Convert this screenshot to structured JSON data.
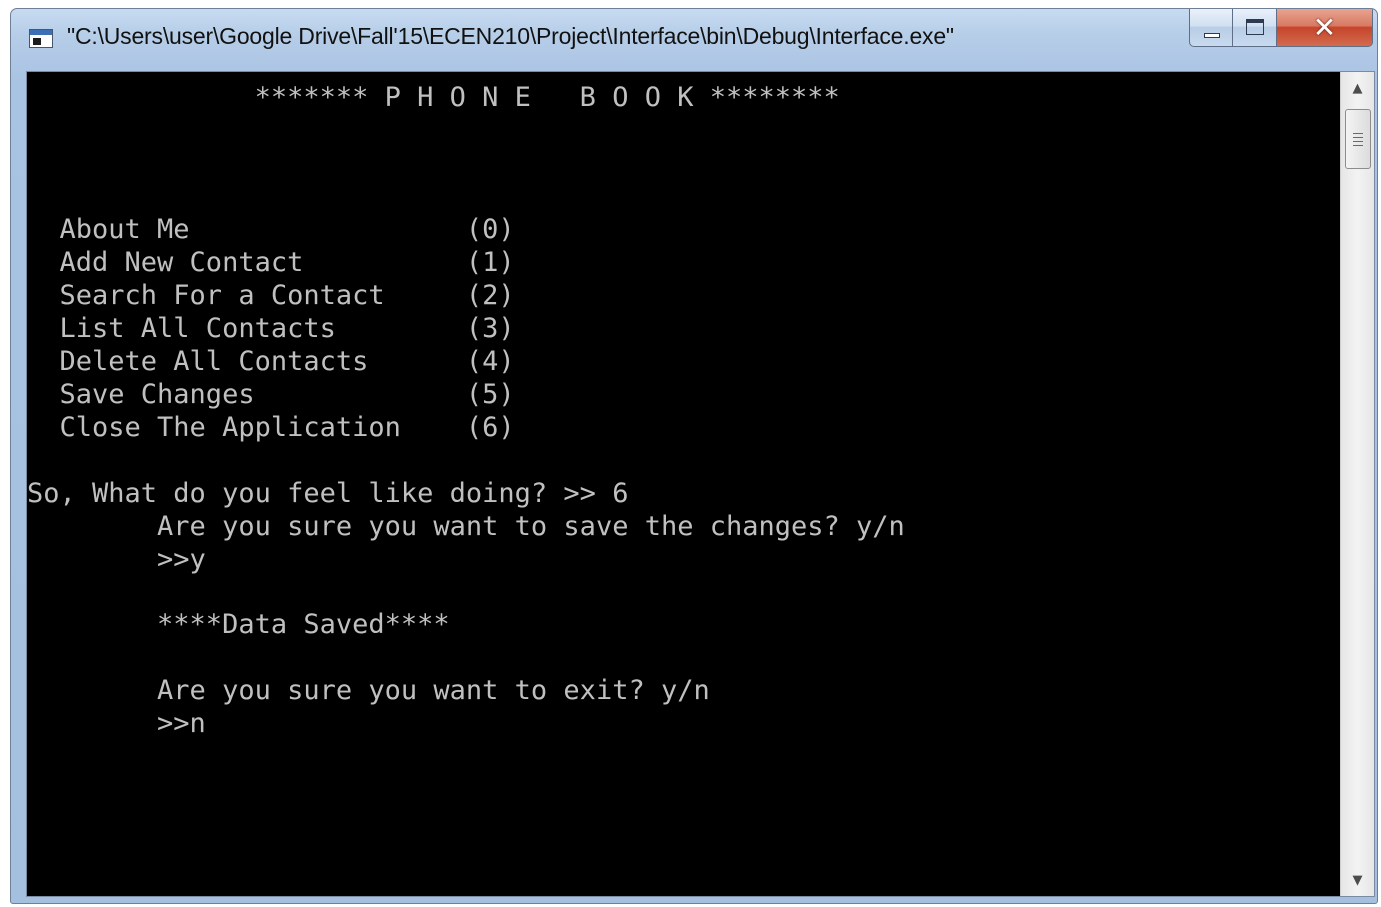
{
  "window": {
    "title": "\"C:\\Users\\user\\Google Drive\\Fall'15\\ECEN210\\Project\\Interface\\bin\\Debug\\Interface.exe\"",
    "close_glyph": "✕"
  },
  "console": {
    "header": "              ******* P H O N E   B O O K ********",
    "menu": [
      {
        "label": "  About Me                 (0)"
      },
      {
        "label": "  Add New Contact          (1)"
      },
      {
        "label": "  Search For a Contact     (2)"
      },
      {
        "label": "  List All Contacts        (3)"
      },
      {
        "label": "  Delete All Contacts      (4)"
      },
      {
        "label": "  Save Changes             (5)"
      },
      {
        "label": "  Close The Application    (6)"
      }
    ],
    "prompt": "So, What do you feel like doing? >> 6",
    "save_question": "        Are you sure you want to save the changes? y/n",
    "save_answer": "        >>y",
    "saved_message": "        ****Data Saved****",
    "exit_question": "        Are you sure you want to exit? y/n",
    "exit_answer": "        >>n"
  },
  "scrollbar": {
    "up_arrow": "▲",
    "down_arrow": "▼"
  }
}
